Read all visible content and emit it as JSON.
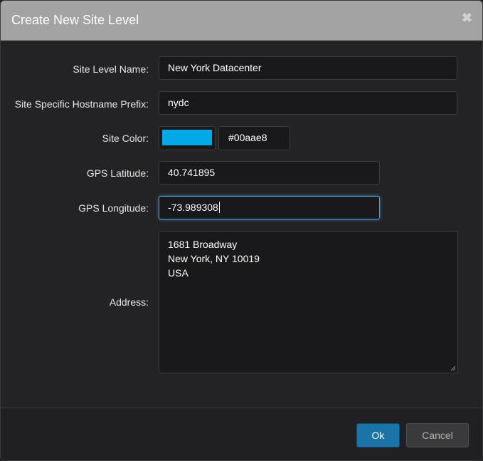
{
  "dialog": {
    "title": "Create New Site Level",
    "close_icon": "close-icon"
  },
  "form": {
    "site_level_name": {
      "label": "Site Level Name:",
      "value": "New York Datacenter"
    },
    "hostname_prefix": {
      "label": "Site Specific Hostname Prefix:",
      "value": "nydc"
    },
    "site_color": {
      "label": "Site Color:",
      "value": "#00aae8",
      "swatch_color": "#00aae8"
    },
    "gps_latitude": {
      "label": "GPS Latitude:",
      "value": "40.741895"
    },
    "gps_longitude": {
      "label": "GPS Longitude:",
      "value": "-73.989308"
    },
    "address": {
      "label": "Address:",
      "lines": [
        "1681 Broadway",
        "New York, NY 10019",
        "USA"
      ]
    }
  },
  "footer": {
    "ok_label": "Ok",
    "cancel_label": "Cancel"
  }
}
